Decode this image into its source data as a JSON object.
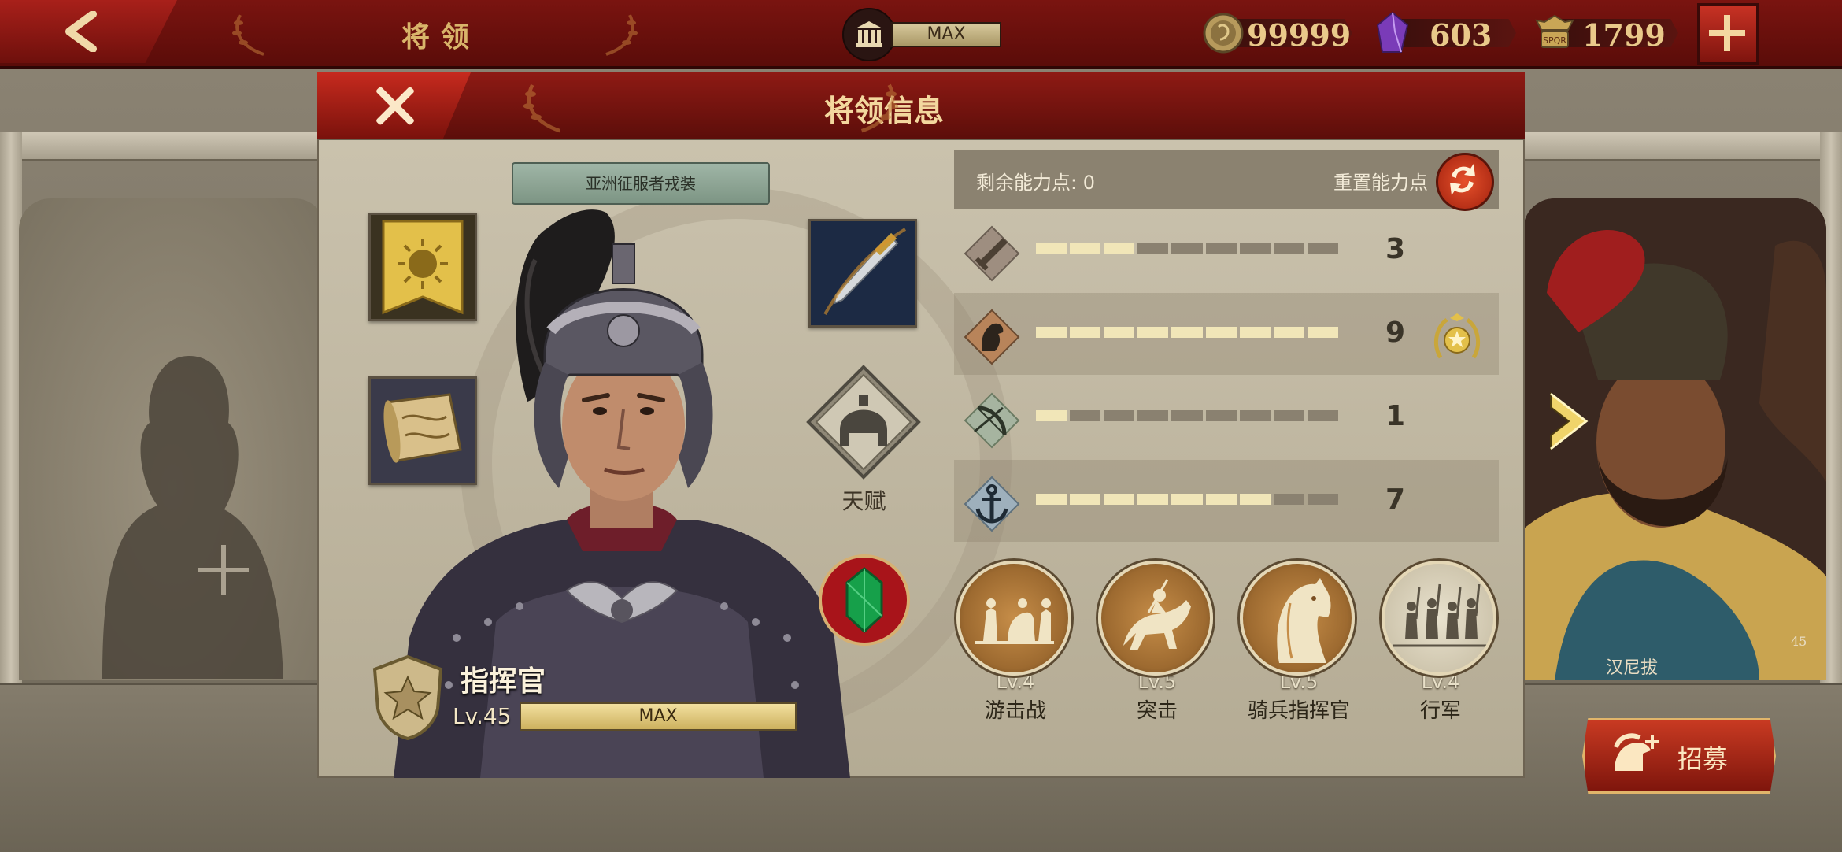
{
  "topbar": {
    "title": "将领",
    "bank_value": "MAX",
    "gold": "99999",
    "gems": "603",
    "spqr": "1799"
  },
  "dialog": {
    "title": "将领信息",
    "outfit_name": "亚洲征服者戎装",
    "talent_label": "天赋",
    "commander": {
      "rank_name": "指挥官",
      "level_text": "Lv.45",
      "level_bar_text": "MAX",
      "level_fraction": 1.0
    },
    "stats": {
      "remaining_points_label": "剩余能力点: 0",
      "reset_label": "重置能力点",
      "rows": [
        {
          "icon": "sword-icon",
          "value": "3",
          "filled": 3,
          "total": 9
        },
        {
          "icon": "horse-icon",
          "value": "9",
          "filled": 9,
          "total": 9,
          "badge": "star-laurel-icon"
        },
        {
          "icon": "bow-icon",
          "value": "1",
          "filled": 1,
          "total": 9
        },
        {
          "icon": "anchor-icon",
          "value": "7",
          "filled": 7,
          "total": 9
        }
      ]
    },
    "skills": [
      {
        "level": "Lv.4",
        "name": "游击战"
      },
      {
        "level": "Lv.5",
        "name": "突击"
      },
      {
        "level": "Lv.5",
        "name": "骑兵指挥官"
      },
      {
        "level": "Lv.4",
        "name": "行军"
      }
    ]
  },
  "background": {
    "right_hero_name": "汉尼拔",
    "right_hero_level": "45"
  },
  "recruit_label": "招募",
  "colors": {
    "topbar_red": "#6a100c",
    "panel_bg": "#c2baa4",
    "accent_gold": "#e9c98a",
    "stat_on": "#f1e6b8",
    "stat_off": "#8a8170"
  }
}
